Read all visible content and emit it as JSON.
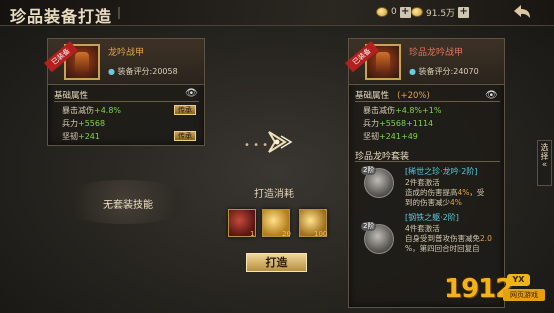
{
  "header": {
    "title": "珍品装备打造",
    "resource1": "0",
    "resource2": "91.5万"
  },
  "left_item": {
    "ribbon": "已装备",
    "name": "龙吟战甲",
    "score_label": "装备评分",
    "score": "20058",
    "attr_title": "基础属性",
    "attrs": [
      {
        "name": "暴击减伤",
        "value": "+4.8%",
        "button": "传承"
      },
      {
        "name": "兵力",
        "value": "+5568"
      },
      {
        "name": "坚韧",
        "value": "+241",
        "button": "传承"
      }
    ],
    "suit_label": "无套装技能"
  },
  "right_item": {
    "ribbon": "已装备",
    "name": "珍品龙吟战甲",
    "score_label": "装备评分",
    "score": "24070",
    "attr_title": "基础属性",
    "attr_bonus": "(+20%)",
    "attrs": [
      {
        "name": "暴击减伤",
        "value": "+4.8%",
        "bonus": "+1%"
      },
      {
        "name": "兵力",
        "value": "+5568",
        "bonus": "+1114"
      },
      {
        "name": "坚韧",
        "value": "+241",
        "bonus": "+49"
      }
    ],
    "suit_title": "珍品龙吟套装",
    "suits": [
      {
        "level": "2阶",
        "name": "[稀世之珍·龙吟·2阶]",
        "line1": "2件套激活",
        "line2": "造成的伤害提高",
        "value2": "4%",
        "line2b": "，受",
        "line3": "到的伤害减少",
        "value3": "4%"
      },
      {
        "level": "2阶",
        "name": "[钢铁之躯·2阶]",
        "line1": "4件套激活",
        "line2": "自身受到普攻伤害减免",
        "value2": "2.0",
        "line3": "%，第四回合时回复自"
      }
    ]
  },
  "center": {
    "consume_title": "打造消耗",
    "materials": [
      {
        "icon": "red-scroll-icon",
        "count": "1"
      },
      {
        "icon": "gold-ingot-icon",
        "count": "20"
      },
      {
        "icon": "gold-ore-icon",
        "count": "100"
      }
    ],
    "forge_label": "打造"
  },
  "side_tab": {
    "label1": "选",
    "label2": "择"
  },
  "watermark": {
    "num": "1912",
    "yx": "YX",
    "sub": "网页游戏"
  }
}
